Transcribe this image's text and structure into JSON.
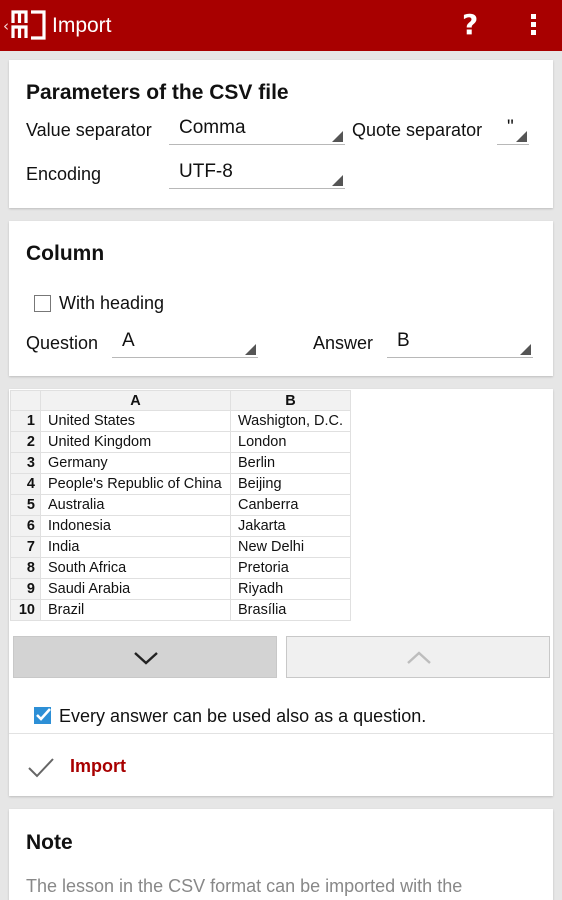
{
  "appbar": {
    "title": "Import",
    "back_glyph": "‹",
    "help_glyph": "?",
    "icons": [
      "memorize-logo-icon",
      "help-icon",
      "overflow-menu-icon"
    ],
    "color": "#a80000"
  },
  "csv_params": {
    "title": "Parameters of the CSV file",
    "value_separator_label": "Value separator",
    "value_separator": "Comma",
    "quote_separator_label": "Quote separator",
    "quote_separator": "\"",
    "encoding_label": "Encoding",
    "encoding": "UTF-8"
  },
  "column": {
    "title": "Column",
    "with_heading_label": "With heading",
    "with_heading_checked": false,
    "question_label": "Question",
    "question_value": "A",
    "answer_label": "Answer",
    "answer_value": "B"
  },
  "preview": {
    "headers": [
      "",
      "A",
      "B"
    ],
    "rows": [
      [
        "1",
        "United States",
        "Washigton, D.C."
      ],
      [
        "2",
        "United Kingdom",
        "London"
      ],
      [
        "3",
        "Germany",
        "Berlin"
      ],
      [
        "4",
        "People's Republic of China",
        "Beijing"
      ],
      [
        "5",
        "Australia",
        "Canberra"
      ],
      [
        "6",
        "Indonesia",
        "Jakarta"
      ],
      [
        "7",
        "India",
        "New Delhi"
      ],
      [
        "8",
        "South Africa",
        "Pretoria"
      ],
      [
        "9",
        "Saudi Arabia",
        "Riyadh"
      ],
      [
        "10",
        "Brazil",
        "Brasília"
      ]
    ]
  },
  "options": {
    "bidirectional_label": "Every answer can be used also as a question.",
    "bidirectional_checked": true,
    "checkbox_color": "#2d8fd6"
  },
  "actions": {
    "import_label": "Import",
    "accent": "#a80000"
  },
  "note": {
    "title": "Note",
    "text": "The lesson in the CSV format can be imported with the"
  }
}
